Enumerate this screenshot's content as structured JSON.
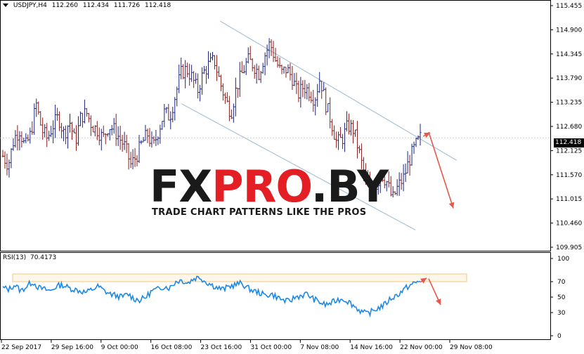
{
  "header": {
    "symbol": "USDJPY,H4",
    "open": "112.260",
    "high": "112.434",
    "low": "111.726",
    "close": "112.418"
  },
  "rsi_header": {
    "name": "RSI(13)",
    "value": "70.4173"
  },
  "current_price": "112.418",
  "watermark": {
    "part1": "FX",
    "part2": "PRO",
    "part3": ".BY",
    "subtitle": "TRADE CHART PATTERNS LIKE THE PROS"
  },
  "colors": {
    "bull_bar": "#1a237e",
    "bear_bar": "#8b1a1a",
    "channel": "#a9c2d6",
    "arrow": "#e8584a",
    "rsi_line": "#1e88e5",
    "rsi_zone": "#f5c77e"
  },
  "chart_data": [
    {
      "type": "bar",
      "subtype": "ohlc",
      "y_axis_ticks": [
        "115.455",
        "114.900",
        "114.345",
        "113.790",
        "113.235",
        "112.680",
        "112.125",
        "111.570",
        "111.015",
        "110.460",
        "109.905"
      ],
      "x_axis_ticks": [
        "22 Sep 2017",
        "29 Sep 16:00",
        "9 Oct 00:00",
        "16 Oct 08:00",
        "23 Oct 16:00",
        "31 Oct 00:00",
        "7 Nov 08:00",
        "14 Nov 16:00",
        "22 Nov 00:00",
        "29 Nov 08:00"
      ],
      "ylim": [
        109.905,
        115.455
      ],
      "close_path": [
        112.0,
        111.8,
        112.4,
        112.6,
        112.2,
        112.5,
        113.2,
        112.6,
        112.4,
        112.7,
        112.9,
        112.5,
        112.8,
        112.3,
        112.9,
        113.0,
        112.7,
        112.6,
        112.4,
        112.7,
        112.6,
        112.4,
        112.2,
        111.8,
        112.0,
        112.3,
        112.5,
        112.2,
        112.6,
        113.0,
        112.9,
        113.4,
        113.9,
        114.0,
        113.8,
        113.5,
        113.9,
        114.1,
        114.2,
        113.7,
        113.3,
        113.0,
        113.6,
        113.9,
        114.2,
        114.1,
        113.9,
        114.3,
        114.6,
        114.2,
        113.9,
        114.0,
        113.8,
        113.4,
        113.6,
        113.5,
        113.3,
        113.8,
        113.2,
        112.8,
        112.3,
        112.4,
        112.7,
        112.6,
        112.1,
        111.5,
        111.2,
        111.3,
        111.6,
        111.4,
        111.0,
        111.3,
        111.5,
        111.9,
        112.2,
        112.418
      ],
      "channel_upper": [
        [
          115.1,
          0.4
        ],
        [
          111.9,
          0.83
        ]
      ],
      "channel_lower": [
        [
          113.2,
          0.33
        ],
        [
          110.3,
          0.755
        ]
      ],
      "projection_arrow": {
        "from": 112.55,
        "to": 110.8
      }
    },
    {
      "type": "line",
      "name": "RSI(13)",
      "y_axis_ticks": [
        "100",
        "70",
        "50",
        "30",
        "0"
      ],
      "ylim": [
        0,
        100
      ],
      "zone": [
        70,
        80
      ],
      "values": [
        62,
        60,
        66,
        58,
        64,
        70,
        62,
        60,
        58,
        64,
        66,
        62,
        60,
        58,
        56,
        60,
        64,
        58,
        54,
        52,
        50,
        54,
        48,
        46,
        50,
        58,
        60,
        64,
        62,
        70,
        72,
        68,
        74,
        76,
        70,
        66,
        62,
        60,
        64,
        66,
        68,
        62,
        58,
        56,
        52,
        54,
        50,
        46,
        44,
        50,
        52,
        54,
        48,
        44,
        40,
        42,
        46,
        48,
        44,
        38,
        32,
        28,
        32,
        36,
        40,
        48,
        52,
        58,
        64,
        68,
        70.4173
      ],
      "projection_arrow": {
        "from": 72,
        "to": 40
      }
    }
  ]
}
